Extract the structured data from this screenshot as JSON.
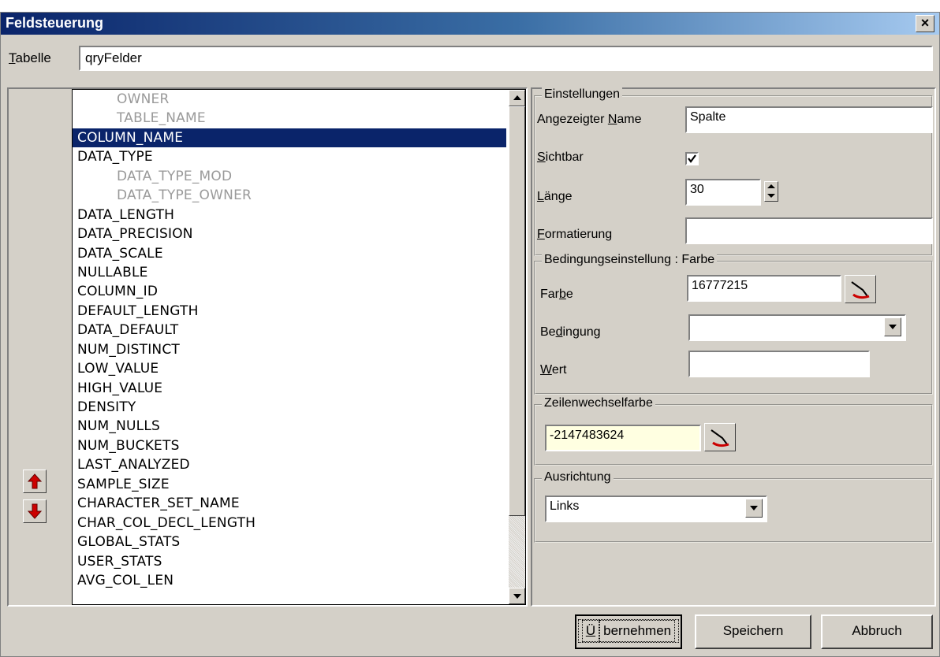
{
  "window": {
    "title": "Feldsteuerung",
    "close_glyph": "×"
  },
  "table": {
    "label_first": "T",
    "label_rest": "abelle",
    "value": "qryFelder"
  },
  "list": {
    "items": [
      {
        "label": "OWNER",
        "style": "indented"
      },
      {
        "label": "TABLE_NAME",
        "style": "indented"
      },
      {
        "label": "COLUMN_NAME",
        "style": "selected"
      },
      {
        "label": "DATA_TYPE",
        "style": "normal"
      },
      {
        "label": "DATA_TYPE_MOD",
        "style": "indented"
      },
      {
        "label": "DATA_TYPE_OWNER",
        "style": "indented"
      },
      {
        "label": "DATA_LENGTH",
        "style": "normal"
      },
      {
        "label": "DATA_PRECISION",
        "style": "normal"
      },
      {
        "label": "DATA_SCALE",
        "style": "normal"
      },
      {
        "label": "NULLABLE",
        "style": "normal"
      },
      {
        "label": "COLUMN_ID",
        "style": "normal"
      },
      {
        "label": "DEFAULT_LENGTH",
        "style": "normal"
      },
      {
        "label": "DATA_DEFAULT",
        "style": "normal"
      },
      {
        "label": "NUM_DISTINCT",
        "style": "normal"
      },
      {
        "label": "LOW_VALUE",
        "style": "normal"
      },
      {
        "label": "HIGH_VALUE",
        "style": "normal"
      },
      {
        "label": "DENSITY",
        "style": "normal"
      },
      {
        "label": "NUM_NULLS",
        "style": "normal"
      },
      {
        "label": "NUM_BUCKETS",
        "style": "normal"
      },
      {
        "label": "LAST_ANALYZED",
        "style": "normal"
      },
      {
        "label": "SAMPLE_SIZE",
        "style": "normal"
      },
      {
        "label": "CHARACTER_SET_NAME",
        "style": "normal"
      },
      {
        "label": "CHAR_COL_DECL_LENGTH",
        "style": "normal"
      },
      {
        "label": "GLOBAL_STATS",
        "style": "normal"
      },
      {
        "label": "USER_STATS",
        "style": "normal"
      },
      {
        "label": "AVG_COL_LEN",
        "style": "normal"
      }
    ]
  },
  "einstellungen": {
    "legend": "Einstellungen",
    "name_label_pre": "Angezeigter ",
    "name_label_u": "N",
    "name_label_post": "ame",
    "name_value": "Spalte",
    "visible_label_u": "S",
    "visible_label_post": "ichtbar",
    "visible_checked": true,
    "length_label_u": "L",
    "length_label_post": "änge",
    "length_value": "30",
    "format_label_u": "F",
    "format_label_post": "ormatierung",
    "format_value": ""
  },
  "bedingung": {
    "legend": "Bedingungseinstellung : Farbe",
    "color_label_pre": "Far",
    "color_label_u": "b",
    "color_label_post": "e",
    "color_value": "16777215",
    "cond_label_pre": "Be",
    "cond_label_u": "d",
    "cond_label_post": "ingung",
    "cond_value": "",
    "value_label_u": "W",
    "value_label_post": "ert",
    "value_value": ""
  },
  "zeilenwechsel": {
    "legend": "Zeilenwechselfarbe",
    "value": "-2147483624"
  },
  "ausrichtung": {
    "legend": "Ausrichtung",
    "value": "Links"
  },
  "buttons": {
    "apply_u": "Ü",
    "apply_rest": "bernehmen",
    "save": "Speichern",
    "cancel": "Abbruch"
  },
  "icons": {
    "move_up": "arrow-up-icon",
    "move_down": "arrow-down-icon",
    "picker": "color-picker-icon",
    "accent_red": "#cc0000"
  }
}
